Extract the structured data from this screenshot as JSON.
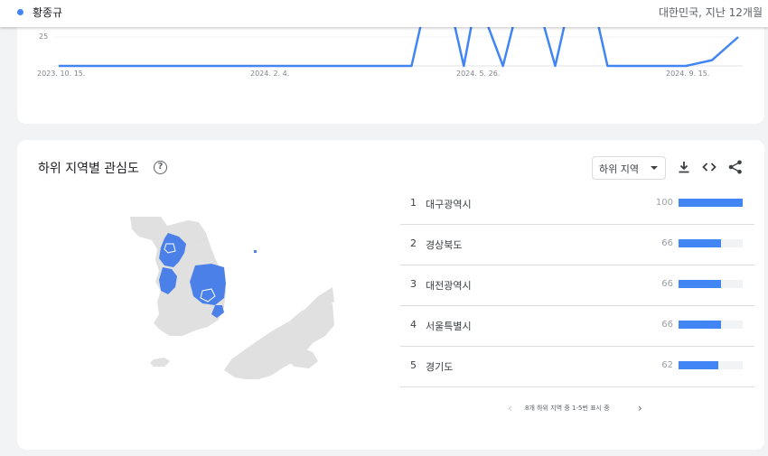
{
  "header": {
    "term": "황종규",
    "term_color": "#4285f4",
    "meta": "대한민국, 지난 12개월"
  },
  "trend_chart": {
    "chart_data": {
      "type": "line",
      "series": [
        {
          "name": "",
          "x": [
            "2023-10-15",
            "2023-11-05",
            "2023-11-26",
            "2023-12-17",
            "2024-01-07",
            "2024-01-28",
            "2024-02-18",
            "2024-03-10",
            "2024-03-31",
            "2024-04-21",
            "2024-05-05",
            "2024-05-19",
            "2024-05-26",
            "2024-06-09",
            "2024-06-16",
            "2024-06-23",
            "2024-06-30",
            "2024-07-07",
            "2024-07-21",
            "2024-08-04",
            "2024-08-18",
            "2024-09-01",
            "2024-09-15",
            "2024-09-29",
            "2024-10-13"
          ],
          "values": [
            0,
            0,
            0,
            0,
            0,
            0,
            0,
            0,
            0,
            0,
            100,
            0,
            60,
            0,
            45,
            55,
            40,
            0,
            100,
            0,
            0,
            0,
            0,
            5,
            25
          ]
        }
      ],
      "y_tick_labels": [
        "25"
      ],
      "x_tick_labels": [
        "2023. 10. 15.",
        "2024. 2. 4.",
        "2024. 5. 26.",
        "2024. 9. 15."
      ],
      "ylim": [
        0,
        100
      ],
      "color": "#4285f4"
    }
  },
  "subregion": {
    "title": "하위 지역별 관심도",
    "help_icon": "help-circle-icon",
    "dropdown_label": "하위 지역",
    "actions": [
      "download-icon",
      "embed-code-icon",
      "share-icon"
    ],
    "rows": [
      {
        "rank": "1",
        "name": "대구광역시",
        "value": "100",
        "fill": 1.0
      },
      {
        "rank": "2",
        "name": "경상북도",
        "value": "66",
        "fill": 0.66
      },
      {
        "rank": "3",
        "name": "대전광역시",
        "value": "66",
        "fill": 0.66
      },
      {
        "rank": "4",
        "name": "서울특별시",
        "value": "66",
        "fill": 0.66
      },
      {
        "rank": "5",
        "name": "경기도",
        "value": "62",
        "fill": 0.62
      }
    ],
    "pager_text": "8개 하위 지역 중 1-5번 표시 중",
    "map_highlight_color": "#4a80e8",
    "map_base_color": "#e0e0e0"
  }
}
